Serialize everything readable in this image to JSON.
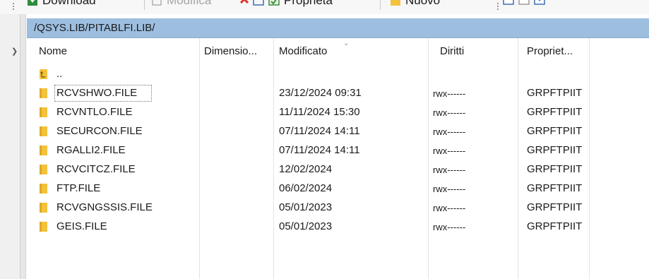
{
  "toolbar": {
    "download_label": "Download",
    "modifica_label": "Modifica",
    "proprieta_label": "Proprietà",
    "nuovo_label": "Nuovo"
  },
  "path": "/QSYS.LIB/PITABLFI.LIB/",
  "columns": {
    "name": "Nome",
    "size": "Dimensio...",
    "modified": "Modificato",
    "rights": "Diritti",
    "owner": "Propriet..."
  },
  "parent_label": "..",
  "files": [
    {
      "name": "RCVSHWO.FILE",
      "modified": "23/12/2024 09:31",
      "rights": "rwx------",
      "owner": "GRPFTPIIT"
    },
    {
      "name": "RCVNTLO.FILE",
      "modified": "11/11/2024 15:30",
      "rights": "rwx------",
      "owner": "GRPFTPIIT"
    },
    {
      "name": "SECURCON.FILE",
      "modified": "07/11/2024 14:11",
      "rights": "rwx------",
      "owner": "GRPFTPIIT"
    },
    {
      "name": "RGALLI2.FILE",
      "modified": "07/11/2024 14:11",
      "rights": "rwx------",
      "owner": "GRPFTPIIT"
    },
    {
      "name": "RCVCITCZ.FILE",
      "modified": "12/02/2024",
      "rights": "rwx------",
      "owner": "GRPFTPIIT"
    },
    {
      "name": "FTP.FILE",
      "modified": "06/02/2024",
      "rights": "rwx------",
      "owner": "GRPFTPIIT"
    },
    {
      "name": "RCVGNGSSIS.FILE",
      "modified": "05/01/2023",
      "rights": "rwx------",
      "owner": "GRPFTPIIT"
    },
    {
      "name": "GEIS.FILE",
      "modified": "05/01/2023",
      "rights": "rwx------",
      "owner": "GRPFTPIIT"
    }
  ],
  "colors": {
    "path_bar": "#9dbedf",
    "folder": "#f2c23c",
    "selection_border": "#777777"
  }
}
